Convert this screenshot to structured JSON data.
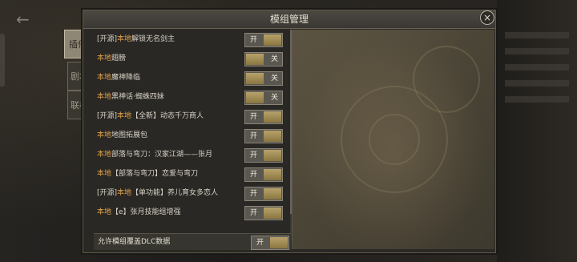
{
  "modal": {
    "title": "模组管理",
    "close_icon": "×"
  },
  "side_tabs": [
    {
      "label": "插件",
      "active": true
    },
    {
      "label": "剧本",
      "active": false
    },
    {
      "label": "联机",
      "active": false
    }
  ],
  "mods": [
    {
      "source": "[开源]",
      "local": "本地",
      "name": "解锁无名剑主",
      "state": "开",
      "enabled": true
    },
    {
      "source": "",
      "local": "本地",
      "name": "翅膀",
      "state": "关",
      "enabled": false
    },
    {
      "source": "",
      "local": "本地",
      "name": "魔神降临",
      "state": "关",
      "enabled": false
    },
    {
      "source": "",
      "local": "本地",
      "name": "黑神话·蜘蛛四妹",
      "state": "关",
      "enabled": false
    },
    {
      "source": "[开源]",
      "local": "本地",
      "name": "【全新】动态千万商人",
      "state": "开",
      "enabled": true
    },
    {
      "source": "",
      "local": "本地",
      "name": "地图拓展包",
      "state": "开",
      "enabled": true
    },
    {
      "source": "",
      "local": "本地",
      "name": "部落与弯刀：汉家江湖——张月",
      "state": "开",
      "enabled": true
    },
    {
      "source": "",
      "local": "本地",
      "name": "【部落与弯刀】恋爱与弯刀",
      "state": "开",
      "enabled": true
    },
    {
      "source": "[开源]",
      "local": "本地",
      "name": "【单功能】养儿育女多恋人",
      "state": "开",
      "enabled": true
    },
    {
      "source": "",
      "local": "本地",
      "name": "【e】张月技能组增强",
      "state": "开",
      "enabled": true
    }
  ],
  "footer": {
    "label": "允许模组覆盖DLC数据",
    "state": "开",
    "enabled": true
  },
  "colors": {
    "local_tag": "#e0a24a",
    "text": "#d7d2c6",
    "toggle_knob": "#b7a26a"
  },
  "back_icon": "←"
}
